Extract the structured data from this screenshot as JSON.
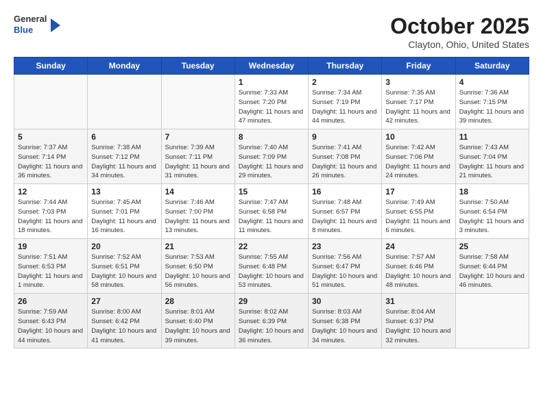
{
  "header": {
    "logo_general": "General",
    "logo_blue": "Blue",
    "title": "October 2025",
    "subtitle": "Clayton, Ohio, United States"
  },
  "days": [
    "Sunday",
    "Monday",
    "Tuesday",
    "Wednesday",
    "Thursday",
    "Friday",
    "Saturday"
  ],
  "weeks": [
    [
      {
        "date": "",
        "info": ""
      },
      {
        "date": "",
        "info": ""
      },
      {
        "date": "",
        "info": ""
      },
      {
        "date": "1",
        "info": "Sunrise: 7:33 AM\nSunset: 7:20 PM\nDaylight: 11 hours and 47 minutes."
      },
      {
        "date": "2",
        "info": "Sunrise: 7:34 AM\nSunset: 7:19 PM\nDaylight: 11 hours and 44 minutes."
      },
      {
        "date": "3",
        "info": "Sunrise: 7:35 AM\nSunset: 7:17 PM\nDaylight: 11 hours and 42 minutes."
      },
      {
        "date": "4",
        "info": "Sunrise: 7:36 AM\nSunset: 7:15 PM\nDaylight: 11 hours and 39 minutes."
      }
    ],
    [
      {
        "date": "5",
        "info": "Sunrise: 7:37 AM\nSunset: 7:14 PM\nDaylight: 11 hours and 36 minutes."
      },
      {
        "date": "6",
        "info": "Sunrise: 7:38 AM\nSunset: 7:12 PM\nDaylight: 11 hours and 34 minutes."
      },
      {
        "date": "7",
        "info": "Sunrise: 7:39 AM\nSunset: 7:11 PM\nDaylight: 11 hours and 31 minutes."
      },
      {
        "date": "8",
        "info": "Sunrise: 7:40 AM\nSunset: 7:09 PM\nDaylight: 11 hours and 29 minutes."
      },
      {
        "date": "9",
        "info": "Sunrise: 7:41 AM\nSunset: 7:08 PM\nDaylight: 11 hours and 26 minutes."
      },
      {
        "date": "10",
        "info": "Sunrise: 7:42 AM\nSunset: 7:06 PM\nDaylight: 11 hours and 24 minutes."
      },
      {
        "date": "11",
        "info": "Sunrise: 7:43 AM\nSunset: 7:04 PM\nDaylight: 11 hours and 21 minutes."
      }
    ],
    [
      {
        "date": "12",
        "info": "Sunrise: 7:44 AM\nSunset: 7:03 PM\nDaylight: 11 hours and 18 minutes."
      },
      {
        "date": "13",
        "info": "Sunrise: 7:45 AM\nSunset: 7:01 PM\nDaylight: 11 hours and 16 minutes."
      },
      {
        "date": "14",
        "info": "Sunrise: 7:46 AM\nSunset: 7:00 PM\nDaylight: 11 hours and 13 minutes."
      },
      {
        "date": "15",
        "info": "Sunrise: 7:47 AM\nSunset: 6:58 PM\nDaylight: 11 hours and 11 minutes."
      },
      {
        "date": "16",
        "info": "Sunrise: 7:48 AM\nSunset: 6:57 PM\nDaylight: 11 hours and 8 minutes."
      },
      {
        "date": "17",
        "info": "Sunrise: 7:49 AM\nSunset: 6:55 PM\nDaylight: 11 hours and 6 minutes."
      },
      {
        "date": "18",
        "info": "Sunrise: 7:50 AM\nSunset: 6:54 PM\nDaylight: 11 hours and 3 minutes."
      }
    ],
    [
      {
        "date": "19",
        "info": "Sunrise: 7:51 AM\nSunset: 6:53 PM\nDaylight: 11 hours and 1 minute."
      },
      {
        "date": "20",
        "info": "Sunrise: 7:52 AM\nSunset: 6:51 PM\nDaylight: 10 hours and 58 minutes."
      },
      {
        "date": "21",
        "info": "Sunrise: 7:53 AM\nSunset: 6:50 PM\nDaylight: 10 hours and 56 minutes."
      },
      {
        "date": "22",
        "info": "Sunrise: 7:55 AM\nSunset: 6:48 PM\nDaylight: 10 hours and 53 minutes."
      },
      {
        "date": "23",
        "info": "Sunrise: 7:56 AM\nSunset: 6:47 PM\nDaylight: 10 hours and 51 minutes."
      },
      {
        "date": "24",
        "info": "Sunrise: 7:57 AM\nSunset: 6:46 PM\nDaylight: 10 hours and 48 minutes."
      },
      {
        "date": "25",
        "info": "Sunrise: 7:58 AM\nSunset: 6:44 PM\nDaylight: 10 hours and 46 minutes."
      }
    ],
    [
      {
        "date": "26",
        "info": "Sunrise: 7:59 AM\nSunset: 6:43 PM\nDaylight: 10 hours and 44 minutes."
      },
      {
        "date": "27",
        "info": "Sunrise: 8:00 AM\nSunset: 6:42 PM\nDaylight: 10 hours and 41 minutes."
      },
      {
        "date": "28",
        "info": "Sunrise: 8:01 AM\nSunset: 6:40 PM\nDaylight: 10 hours and 39 minutes."
      },
      {
        "date": "29",
        "info": "Sunrise: 8:02 AM\nSunset: 6:39 PM\nDaylight: 10 hours and 36 minutes."
      },
      {
        "date": "30",
        "info": "Sunrise: 8:03 AM\nSunset: 6:38 PM\nDaylight: 10 hours and 34 minutes."
      },
      {
        "date": "31",
        "info": "Sunrise: 8:04 AM\nSunset: 6:37 PM\nDaylight: 10 hours and 32 minutes."
      },
      {
        "date": "",
        "info": ""
      }
    ]
  ]
}
